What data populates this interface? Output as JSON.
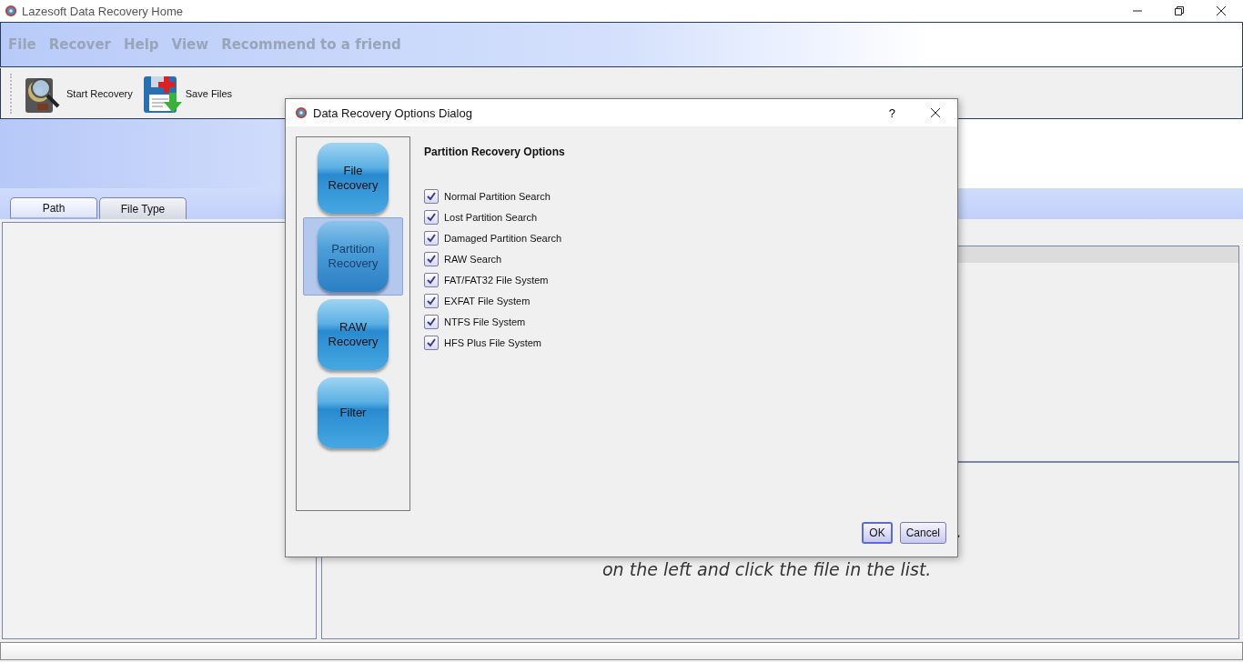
{
  "window": {
    "title": "Lazesoft Data Recovery Home"
  },
  "menu": [
    "File",
    "Recover",
    "Help",
    "View",
    "Recommend to a friend"
  ],
  "toolbar": [
    {
      "label": "Start Recovery",
      "kind": "disk"
    },
    {
      "label": "Save Files",
      "kind": "save"
    }
  ],
  "tabs": [
    {
      "label": "Path",
      "selected": true
    },
    {
      "label": "File Type",
      "selected": false
    }
  ],
  "hint_lines": [
    ".",
    "on the left and click the file in the list."
  ],
  "dialog": {
    "title": "Data Recovery Options Dialog",
    "help": "?",
    "nav": [
      {
        "label": "File\nRecovery",
        "selected": false
      },
      {
        "label": "Partition\nRecovery",
        "selected": true
      },
      {
        "label": "RAW\nRecovery",
        "selected": false
      },
      {
        "label": "Filter",
        "selected": false
      }
    ],
    "heading": "Partition Recovery Options",
    "options": [
      {
        "label": "Normal Partition Search",
        "checked": true
      },
      {
        "label": "Lost Partition Search",
        "checked": true
      },
      {
        "label": "Damaged Partition Search",
        "checked": true
      },
      {
        "label": "RAW Search",
        "checked": true
      },
      {
        "label": "FAT/FAT32 File System",
        "checked": true
      },
      {
        "label": "EXFAT File System",
        "checked": true
      },
      {
        "label": "NTFS File System",
        "checked": true
      },
      {
        "label": "HFS Plus File System",
        "checked": true
      }
    ],
    "buttons": [
      {
        "label": "OK",
        "kind": "default"
      },
      {
        "label": "Cancel",
        "kind": "normal"
      }
    ]
  }
}
